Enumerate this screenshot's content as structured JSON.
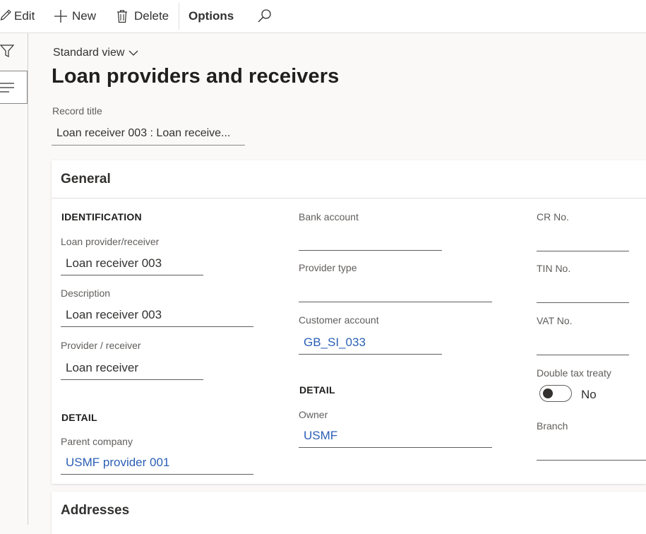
{
  "toolbar": {
    "edit_label": "Edit",
    "new_label": "New",
    "delete_label": "Delete",
    "options_label": "Options"
  },
  "header": {
    "view_label": "Standard view",
    "page_title": "Loan providers and receivers",
    "record_title_label": "Record title",
    "record_title_value": "Loan receiver 003 : Loan receive..."
  },
  "general": {
    "title": "General",
    "identification": {
      "heading": "IDENTIFICATION",
      "provider_receiver_label": "Loan provider/receiver",
      "provider_receiver_value": "Loan receiver 003",
      "description_label": "Description",
      "description_value": "Loan receiver 003",
      "type_label": "Provider / receiver",
      "type_value": "Loan receiver"
    },
    "detail_left": {
      "heading": "DETAIL",
      "parent_company_label": "Parent company",
      "parent_company_value": "USMF provider 001"
    },
    "middle": {
      "bank_account_label": "Bank account",
      "bank_account_value": "",
      "provider_type_label": "Provider type",
      "provider_type_value": "",
      "customer_account_label": "Customer account",
      "customer_account_value": "GB_SI_033",
      "detail_heading": "DETAIL",
      "owner_label": "Owner",
      "owner_value": "USMF"
    },
    "right": {
      "cr_label": "CR No.",
      "cr_value": "",
      "tin_label": "TIN No.",
      "tin_value": "",
      "vat_label": "VAT No.",
      "vat_value": "",
      "double_tax_label": "Double tax treaty",
      "double_tax_value": "No",
      "branch_label": "Branch",
      "branch_value": ""
    }
  },
  "addresses": {
    "title": "Addresses"
  },
  "colors": {
    "link": "#2b5fb5",
    "background": "#faf9f8",
    "card": "#ffffff"
  }
}
